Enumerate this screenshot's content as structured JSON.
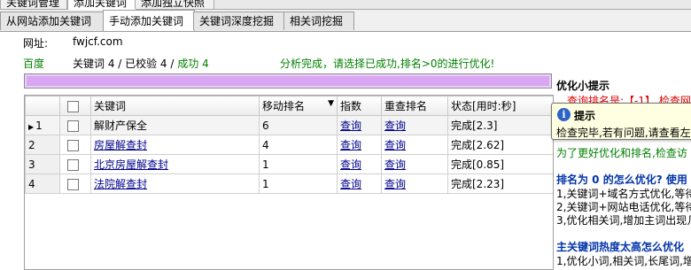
{
  "top_tabs": [
    "关键词管理",
    "添加关键词",
    "添加独立快照"
  ],
  "sub_tabs": [
    "从网站添加关键词",
    "手动添加关键词",
    "关键词深度挖掘",
    "相关词挖掘"
  ],
  "url": {
    "label": "网址:",
    "value": "fwjcf.com"
  },
  "engine": "百度",
  "stats": {
    "prefix": "关键词 4 / 已校验 4 / ",
    "success": "成功 4"
  },
  "status_message": "分析完成，请选择已成功,排名>0的进行优化!",
  "progress": 1.0,
  "table": {
    "columns": [
      "",
      "",
      "关键词",
      "移动排名",
      "指数",
      "重查排名",
      "状态[用时:秒]"
    ],
    "rows": [
      {
        "n": "1",
        "keyword": "解财产保全",
        "rank": "6",
        "index": "查询",
        "recheck": "查询",
        "status": "完成[2.3]"
      },
      {
        "n": "2",
        "keyword": "房屋解查封",
        "rank": "4",
        "index": "查询",
        "recheck": "查询",
        "status": "完成[2.62]"
      },
      {
        "n": "3",
        "keyword": "北京房屋解查封",
        "rank": "1",
        "index": "查询",
        "recheck": "查询",
        "status": "完成[0.85]"
      },
      {
        "n": "4",
        "keyword": "法院解查封",
        "rank": "1",
        "index": "查询",
        "recheck": "查询",
        "status": "完成[2.23]"
      }
    ]
  },
  "tips": {
    "title": "优化小提示",
    "red": "查询排名是:【-1】 检查网",
    "green": "为了更好优化和排名,检查访",
    "h1": "排名为 0 的怎么优化? 使用",
    "l1": "1,关键词+域名方式优化,等待",
    "l2": "2,关键词+网站电话优化,等待",
    "l3": "3,优化相关词,增加主词出现几",
    "h2": "主关键词热度太高怎么优化",
    "l4": "1,优化小词,相关词,长尾词,增"
  },
  "tooltip": {
    "title": "提示",
    "text": "检查完毕,若有问题,请查看左"
  }
}
